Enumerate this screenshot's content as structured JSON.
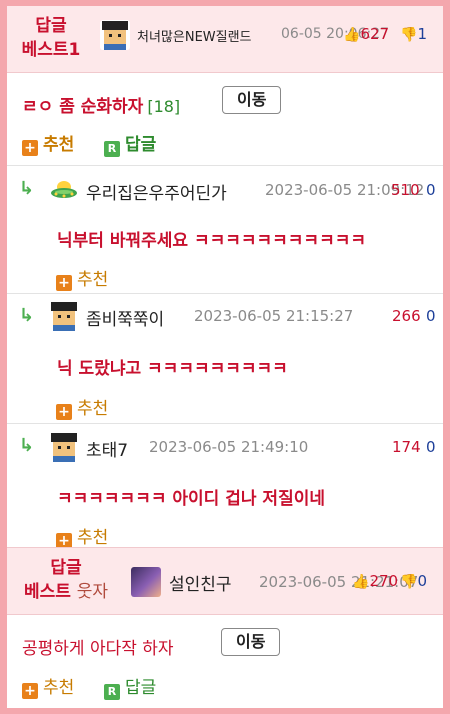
{
  "best1": {
    "label_line1": "답글",
    "label_line2": "베스트1",
    "nickname": "처녀많은NEW질랜드",
    "date": "06-05 20:06:27",
    "votes_up": "627",
    "votes_down": "1",
    "title": "ㄹㅇ 좀 순화하자",
    "reply_count": "[18]",
    "move_label": "이동",
    "recommend_label": "추천",
    "reply_label": "답글"
  },
  "comments": [
    {
      "nickname": "우리집은우주어딘가",
      "date": "2023-06-05 21:09:12",
      "votes_up": "510",
      "votes_down": "0",
      "text": "닉부터 바꿔주세요 ㅋㅋㅋㅋㅋㅋㅋㅋㅋㅋㅋ",
      "recommend_label": "추천"
    },
    {
      "nickname": "좀비쭉쭉이",
      "date": "2023-06-05 21:15:27",
      "votes_up": "266",
      "votes_down": "0",
      "text": "닉 도랐냐고 ㅋㅋㅋㅋㅋㅋㅋㅋㅋ",
      "recommend_label": "추천"
    },
    {
      "nickname": "초태7",
      "date": "2023-06-05 21:49:10",
      "votes_up": "174",
      "votes_down": "0",
      "text": "ㅋㅋㅋㅋㅋㅋㅋ 아이디 겁나 저질이네",
      "recommend_label": "추천"
    }
  ],
  "best2": {
    "label_line1": "답글",
    "label_line2a": "베스트",
    "label_line2b": "웃자",
    "nickname": "설인친구",
    "date": "2023-06-05 21:21:07",
    "votes_up": "270",
    "votes_down": "0",
    "title": "공평하게 아다작 하자",
    "move_label": "이동",
    "recommend_label": "추천",
    "reply_label": "답글"
  },
  "icons": {
    "reply_arrow": "reply-arrow-icon",
    "thumb_up": "thumb-up-icon",
    "thumb_down": "thumb-down-icon",
    "plus": "plus-icon",
    "reply_badge": "reply-badge-icon"
  },
  "colors": {
    "accent_red": "#c8102e",
    "accent_blue": "#1d3f99",
    "recommend_orange": "#c77b00",
    "reply_green": "#2e8b2e",
    "border_pink": "#f4a7ad",
    "header_bg": "#fde8ea"
  }
}
